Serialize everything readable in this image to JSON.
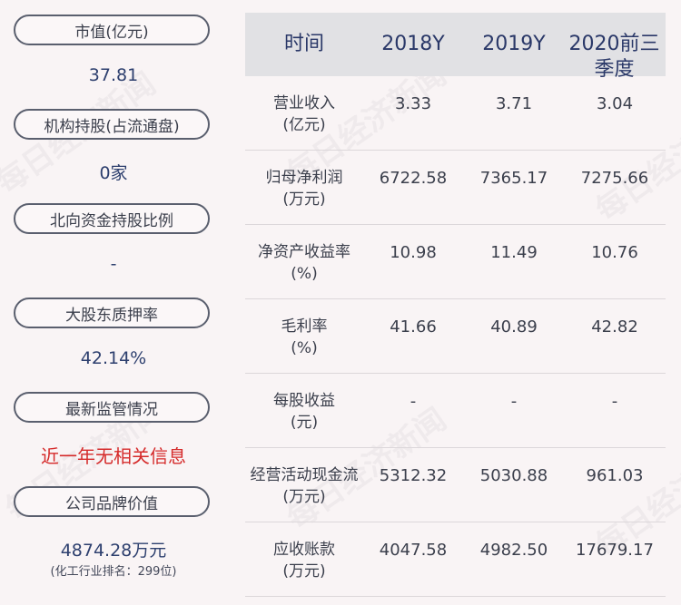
{
  "left_panel": {
    "items": [
      {
        "label": "市值(亿元)",
        "value": "37.81"
      },
      {
        "label": "机构持股(占流通盘)",
        "value": "0家"
      },
      {
        "label": "北向资金持股比例",
        "value": "-"
      },
      {
        "label": "大股东质押率",
        "value": "42.14%"
      },
      {
        "label": "最新监管情况",
        "value": "近一年无相关信息"
      },
      {
        "label": "公司品牌价值",
        "value": "4874.28万元",
        "sub": "(化工行业排名：299位)"
      }
    ]
  },
  "table": {
    "headers": [
      "时间",
      "2018Y",
      "2019Y",
      "2020前三季度"
    ],
    "rows": [
      {
        "label_1": "营业收入",
        "label_2": "(亿元)",
        "values": [
          "3.33",
          "3.71",
          "3.04"
        ]
      },
      {
        "label_1": "归母净利润",
        "label_2": "(万元)",
        "values": [
          "6722.58",
          "7365.17",
          "7275.66"
        ]
      },
      {
        "label_1": "净资产收益率",
        "label_2": "(%)",
        "values": [
          "10.98",
          "11.49",
          "10.76"
        ]
      },
      {
        "label_1": "毛利率",
        "label_2": "(%)",
        "values": [
          "41.66",
          "40.89",
          "42.82"
        ]
      },
      {
        "label_1": "每股收益",
        "label_2": "(元)",
        "values": [
          "-",
          "-",
          "-"
        ]
      },
      {
        "label_1": "经营活动现金流",
        "label_2": "(万元)",
        "values": [
          "5312.32",
          "5030.88",
          "961.03"
        ]
      },
      {
        "label_1": "应收账款",
        "label_2": "(万元)",
        "values": [
          "4047.58",
          "4982.50",
          "17679.17"
        ]
      }
    ]
  },
  "watermark": "每日经济新闻"
}
